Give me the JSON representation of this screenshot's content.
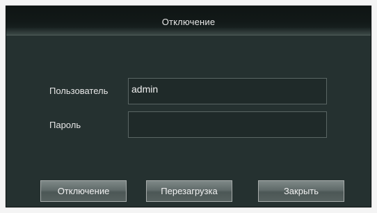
{
  "dialog": {
    "title": "Отключение"
  },
  "form": {
    "user_label": "Пользователь",
    "user_value": "admin",
    "password_label": "Пароль",
    "password_value": ""
  },
  "buttons": {
    "shutdown": "Отключение",
    "reboot": "Перезагрузка",
    "close": "Закрыть"
  }
}
